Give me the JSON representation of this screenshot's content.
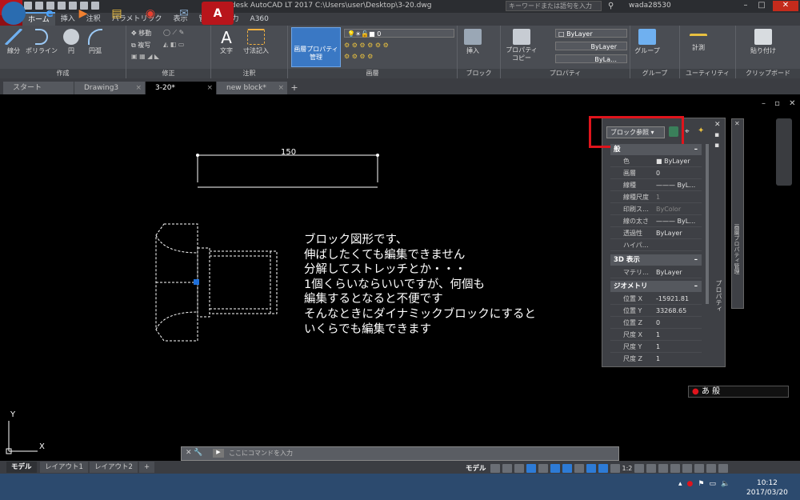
{
  "window": {
    "app_logo": "A",
    "app_logo_sub": "LT",
    "title": "Autodesk AutoCAD LT 2017    C:\\Users\\user\\Desktop\\3-20.dwg",
    "search_placeholder": "キーワードまたは語句を入力",
    "user": "wada28530"
  },
  "menu": {
    "tabs": [
      "ホーム",
      "挿入",
      "注釈",
      "パラメトリック",
      "表示",
      "管理",
      "出力",
      "A360"
    ],
    "active": "ホーム"
  },
  "ribbon": {
    "draw": {
      "title": "作成",
      "line": "線分",
      "polyline": "ポリライン",
      "circle": "円",
      "arc": "円弧"
    },
    "modify": {
      "title": "修正",
      "move": "移動",
      "copy": "複写"
    },
    "annotation": {
      "title": "注釈",
      "text": "文字",
      "dimension": "寸法記入"
    },
    "layers": {
      "title": "画層",
      "layer_props": "画層プロパティ\n管理",
      "current_layer": "0"
    },
    "block": {
      "title": "ブロック",
      "insert": "挿入"
    },
    "properties": {
      "title": "プロパティ",
      "match": "プロパティ\nコピー",
      "color": "ByLayer",
      "linetype": "ByLayer",
      "lineweight": "ByLa…"
    },
    "groups": {
      "title": "グループ",
      "group": "グループ"
    },
    "utilities": {
      "title": "ユーティリティ",
      "measure": "計測"
    },
    "clipboard": {
      "title": "クリップボード",
      "paste": "貼り付け"
    }
  },
  "doc_tabs": [
    {
      "label": "スタート",
      "active": false
    },
    {
      "label": "Drawing3",
      "active": false
    },
    {
      "label": "3-20*",
      "active": true
    },
    {
      "label": "new block*",
      "active": false
    }
  ],
  "canvas": {
    "dimension_value": "150",
    "note": "ブロック図形です、\n伸ばしたくても編集できません\n分解してストレッチとか・・・\n1個くらいならいいですが、何個も\n編集するとなると不便です\nそんなときにダイナミックブロックにすると\nいくらでも編集できます",
    "ucs_x": "X",
    "ucs_y": "Y"
  },
  "properties_palette": {
    "selection": "ブロック参照",
    "vertical_title": "プロパティ",
    "sections": [
      {
        "title": "般",
        "rows": [
          {
            "key": "色",
            "value": "■ ByLayer"
          },
          {
            "key": "画層",
            "value": "0"
          },
          {
            "key": "線種",
            "value": "——— ByL…"
          },
          {
            "key": "線種尺度",
            "value": "1"
          },
          {
            "key": "印刷ス…",
            "value": "ByColor"
          },
          {
            "key": "線の太さ",
            "value": "——— ByL…"
          },
          {
            "key": "透過性",
            "value": "ByLayer"
          },
          {
            "key": "ハイパ…",
            "value": ""
          }
        ]
      },
      {
        "title": "3D 表示",
        "rows": [
          {
            "key": "マテリ…",
            "value": "ByLayer"
          }
        ]
      },
      {
        "title": "ジオメトリ",
        "rows": [
          {
            "key": "位置 X",
            "value": "-15921.81"
          },
          {
            "key": "位置 Y",
            "value": "33268.65"
          },
          {
            "key": "位置 Z",
            "value": "0"
          },
          {
            "key": "尺度 X",
            "value": "1"
          },
          {
            "key": "尺度 Y",
            "value": "1"
          },
          {
            "key": "尺度 Z",
            "value": "1"
          }
        ]
      }
    ]
  },
  "layer_palette": {
    "vertical_title": "画層プロパティ管理"
  },
  "ime": {
    "label": "あ 般"
  },
  "command_line": {
    "placeholder": "ここにコマンドを入力"
  },
  "layout_tabs": [
    "モデル",
    "レイアウト1",
    "レイアウト2"
  ],
  "status": {
    "model": "モデル",
    "scale": "1:2"
  },
  "taskbar": {
    "time": "10:12",
    "date": "2017/03/20"
  },
  "colors": {
    "accent_red": "#e0141c",
    "selection_blue": "#1e6fd9",
    "canvas": "#000000"
  }
}
